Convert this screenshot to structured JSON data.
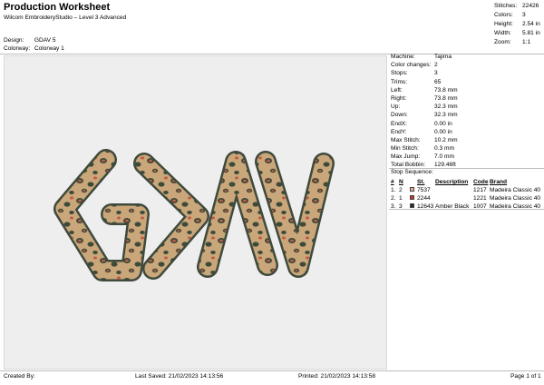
{
  "header": {
    "title": "Production Worksheet",
    "subtitle": "Wilcom EmbroideryStudio – Level 3 Advanced"
  },
  "design_info": {
    "design_label": "Design:",
    "design_value": "GDAV 5",
    "colorway_label": "Colorway:",
    "colorway_value": "Colorway 1"
  },
  "summary": [
    {
      "label": "Stitches:",
      "value": "22426"
    },
    {
      "label": "Colors:",
      "value": "3"
    },
    {
      "label": "Height:",
      "value": "2.54 in"
    },
    {
      "label": "Width:",
      "value": "5.81 in"
    },
    {
      "label": "Zoom:",
      "value": "1:1"
    }
  ],
  "machine_info": [
    {
      "label": "Machine:",
      "value": "Tajima"
    },
    {
      "label": "Color changes:",
      "value": "2"
    },
    {
      "label": "Stops:",
      "value": "3"
    },
    {
      "label": "Trims:",
      "value": "65"
    },
    {
      "label": "Left:",
      "value": "73.8 mm"
    },
    {
      "label": "Right:",
      "value": "73.8 mm"
    },
    {
      "label": "Up:",
      "value": "32.3 mm"
    },
    {
      "label": "Down:",
      "value": "32.3 mm"
    },
    {
      "label": "EndX:",
      "value": "0.00 in"
    },
    {
      "label": "EndY:",
      "value": "0.00 in"
    },
    {
      "label": "Max Stitch:",
      "value": "10.2 mm"
    },
    {
      "label": "Min Stitch:",
      "value": "0.3 mm"
    },
    {
      "label": "Max Jump:",
      "value": "7.0 mm"
    },
    {
      "label": "Total Bobbin:",
      "value": "129.46ft"
    }
  ],
  "stop_sequence": {
    "title": "Stop Sequence:",
    "headers": {
      "num": "#",
      "n": "N",
      "st": "St.",
      "description": "Description",
      "code": "Code",
      "brand": "Brand"
    },
    "rows": [
      {
        "num": "1.",
        "n": "2",
        "st": "7537",
        "description": "",
        "code": "1217",
        "brand": "Madeira Classic 40",
        "color": "#e8b08f"
      },
      {
        "num": "2.",
        "n": "1",
        "st": "2244",
        "description": "",
        "code": "1221",
        "brand": "Madeira Classic 40",
        "color": "#c0392b"
      },
      {
        "num": "3.",
        "n": "3",
        "st": "12643",
        "description": "Amber Black",
        "code": "1007",
        "brand": "Madeira Classic 40",
        "color": "#2a2a2a"
      }
    ]
  },
  "footer": {
    "created_by": "Created By:",
    "last_saved": "Last Saved: 21/02/2023 14:13:56",
    "printed": "Printed: 21/02/2023 14:13:58",
    "page": "Page 1 of 1"
  },
  "colors": {
    "outline": "#3f4a3c",
    "base": "#c9a77a",
    "spot_dark": "#3d4a3a",
    "spot_red": "#c25a45"
  }
}
